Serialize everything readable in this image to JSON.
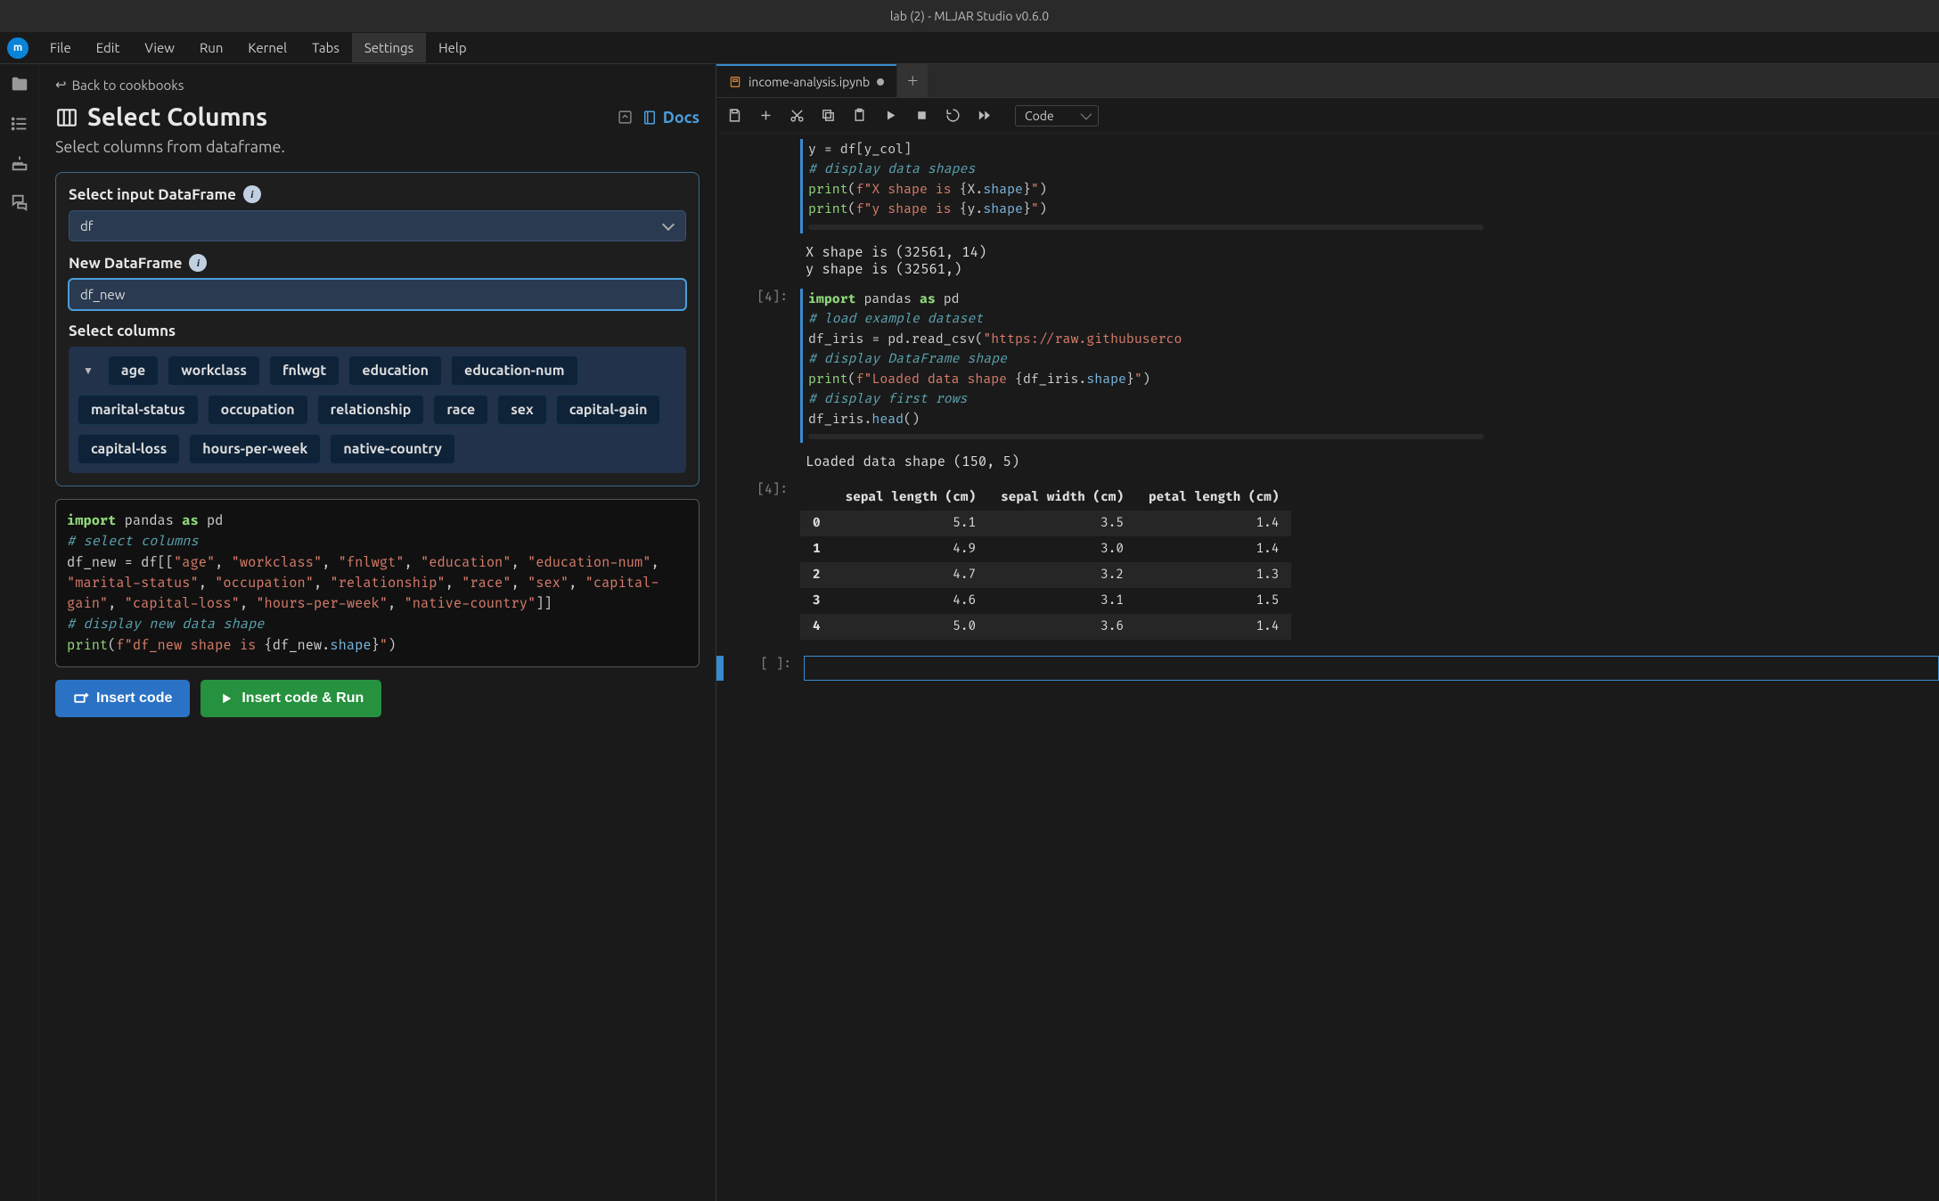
{
  "window": {
    "title": "lab (2) - MLJAR Studio v0.6.0"
  },
  "menubar": [
    "File",
    "Edit",
    "View",
    "Run",
    "Kernel",
    "Tabs",
    "Settings",
    "Help"
  ],
  "menubar_active": "Settings",
  "back_link": "Back to cookbooks",
  "page": {
    "title": "Select Columns",
    "subtitle": "Select columns from dataframe.",
    "docs": "Docs"
  },
  "form": {
    "input_df_label": "Select input DataFrame",
    "input_df_value": "df",
    "new_df_label": "New DataFrame",
    "new_df_value": "df_new",
    "columns_label": "Select columns",
    "columns": [
      "age",
      "workclass",
      "fnlwgt",
      "education",
      "education-num",
      "marital-status",
      "occupation",
      "relationship",
      "race",
      "sex",
      "capital-gain",
      "capital-loss",
      "hours-per-week",
      "native-country"
    ]
  },
  "generated_code": {
    "line1_import": "import",
    "line1_pandas": " pandas ",
    "line1_as": "as",
    "line1_pd": " pd",
    "line2": "# select columns",
    "line3a": "df_new = df[[",
    "line3_list_close": "]]",
    "cols_quoted": [
      "\"age\"",
      "\"workclass\"",
      "\"fnlwgt\"",
      "\"education\"",
      "\"education-num\"",
      "\"marital-status\"",
      "\"occupation\"",
      "\"relationship\"",
      "\"race\"",
      "\"sex\"",
      "\"capital-gain\"",
      "\"capital-loss\"",
      "\"hours-per-week\"",
      "\"native-country\""
    ],
    "line4": "# display new data shape",
    "line5a": "print",
    "line5b": "(f\"df_new shape is ",
    "line5c": "{df_new.",
    "line5d": "shape",
    "line5e": "}",
    "line5f": "\")"
  },
  "buttons": {
    "insert": "Insert code",
    "run": "Insert code & Run"
  },
  "notebook": {
    "tab_name": "income-analysis.ipynb",
    "celltype": "Code",
    "cell1_prompt": "",
    "cell1_lines": {
      "l1": "y = df[y_col]",
      "l2": "# display data shapes",
      "l3a": "print",
      "l3b": "(f\"X shape is ",
      "l3c": "{X.",
      "l3d": "shape",
      "l3e": "}\"",
      "l3f": ")",
      "l4a": "print",
      "l4b": "(f\"y shape is ",
      "l4c": "{y.",
      "l4d": "shape",
      "l4e": "}\"",
      "l4f": ")"
    },
    "cell1_out1": "X shape is (32561, 14)",
    "cell1_out2": "y shape is (32561,)",
    "cell2_prompt": "[4]:",
    "cell2_lines": {
      "l1a": "import",
      "l1b": " pandas ",
      "l1c": "as",
      "l1d": " pd",
      "l2": "# load example dataset",
      "l3a": "df_iris = pd.read_csv(",
      "l3b": "\"https://raw.githubuserco",
      "l4": "# display DataFrame shape",
      "l5a": "print",
      "l5b": "(f\"Loaded data shape ",
      "l5c": "{df_iris.",
      "l5d": "shape",
      "l5e": "}\"",
      "l5f": ")",
      "l6": "# display first rows",
      "l7a": "df_iris.",
      "l7b": "head",
      "l7c": "()"
    },
    "cell2_out_prompt": "[4]:",
    "cell2_out_text": "Loaded data shape (150, 5)",
    "table": {
      "headers": [
        "",
        "sepal length (cm)",
        "sepal width (cm)",
        "petal length (cm)"
      ],
      "rows": [
        [
          "0",
          "5.1",
          "3.5",
          "1.4"
        ],
        [
          "1",
          "4.9",
          "3.0",
          "1.4"
        ],
        [
          "2",
          "4.7",
          "3.2",
          "1.3"
        ],
        [
          "3",
          "4.6",
          "3.1",
          "1.5"
        ],
        [
          "4",
          "5.0",
          "3.6",
          "1.4"
        ]
      ]
    },
    "empty_prompt": "[ ]:"
  }
}
